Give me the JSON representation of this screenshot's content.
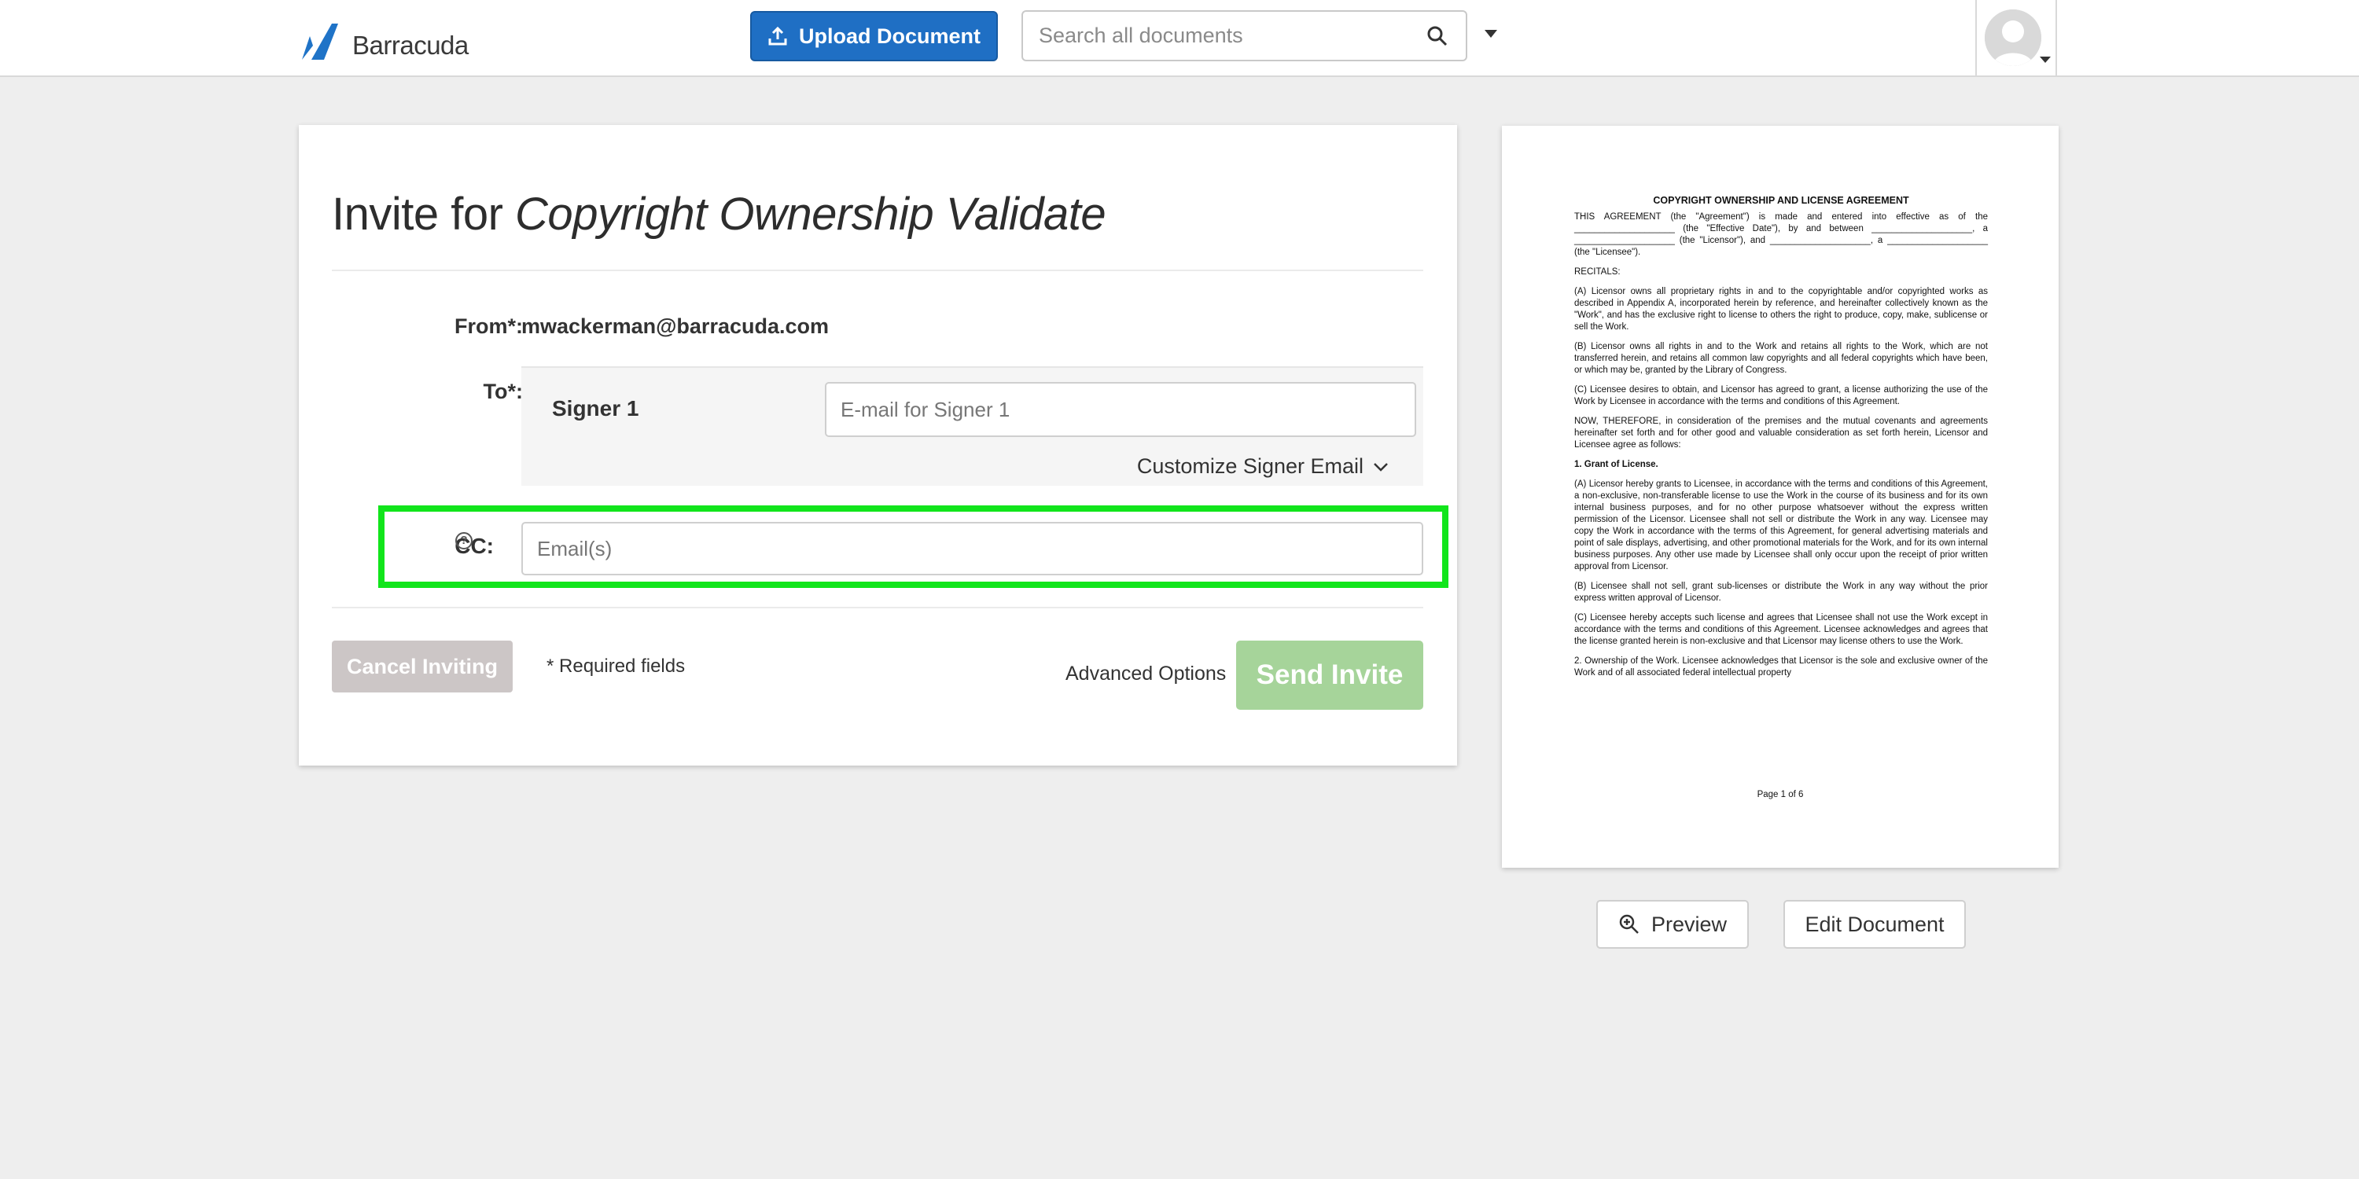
{
  "header": {
    "logo_text": "Barracuda",
    "upload_label": "Upload Document",
    "search_placeholder": "Search all documents"
  },
  "invite": {
    "title_prefix": "Invite for ",
    "title_doc": "Copyright Ownership Validate",
    "from_label": "From*:",
    "from_value": "mwackerman@barracuda.com",
    "to_label": "To*:",
    "signer_name": "Signer 1",
    "signer_placeholder": "E-mail for Signer 1",
    "customize_label": "Customize Signer Email",
    "cc_label": "CC:",
    "cc_placeholder": "Email(s)",
    "cancel_label": "Cancel Inviting",
    "required_note": "* Required fields",
    "advanced_label": "Advanced Options",
    "send_label": "Send Invite"
  },
  "document": {
    "title": "COPYRIGHT OWNERSHIP AND LICENSE AGREEMENT",
    "paragraphs": [
      "THIS AGREEMENT (the \"Agreement\") is made and entered into effective as of the ____________________ (the \"Effective Date\"), by and between ____________________, a ____________________ (the \"Licensor\"), and ____________________, a ____________________ (the \"Licensee\").",
      "RECITALS:",
      "(A) Licensor owns all proprietary rights in and to the copyrightable and/or copyrighted works as described in Appendix A, incorporated herein by reference, and hereinafter collectively known as the \"Work\", and has the exclusive right to license to others the right to produce, copy, make, sublicense or sell the Work.",
      "(B) Licensor owns all rights in and to the Work and retains all rights to the Work, which are not transferred herein, and retains all common law copyrights and all federal copyrights which have been, or which may be, granted by the Library of Congress.",
      "(C) Licensee desires to obtain, and Licensor has agreed to grant, a license authorizing the use of the Work by Licensee in accordance with the terms and conditions of this Agreement.",
      "NOW, THEREFORE, in consideration of the premises and the mutual covenants and agreements hereinafter set forth and for other good and valuable consideration as set forth herein, Licensor and Licensee agree as follows:",
      "1. Grant of License.",
      "(A) Licensor hereby grants to Licensee, in accordance with the terms and conditions of this Agreement, a non-exclusive, non-transferable license to use the Work in the course of its business and for its own internal business purposes, and for no other purpose whatsoever without the express written permission of the Licensor. Licensee shall not sell or distribute the Work in any way. Licensee may copy the Work in accordance with the terms of this Agreement, for general advertising materials and point of sale displays, advertising, and other promotional materials for the Work, and for its own internal business purposes. Any other use made by Licensee shall only occur upon the receipt of prior written approval from Licensor.",
      "(B) Licensee shall not sell, grant sub-licenses or distribute the Work in any way without the prior express written approval of Licensor.",
      "(C) Licensee hereby accepts such license and agrees that Licensee shall not use the Work except in accordance with the terms and conditions of this Agreement. Licensee acknowledges and agrees that the license granted herein is non-exclusive and that Licensor may license others to use the Work.",
      "2. Ownership of the Work. Licensee acknowledges that Licensor is the sole and exclusive owner of the Work and of all associated federal intellectual property"
    ],
    "footer": "Page 1 of 6",
    "preview_label": "Preview",
    "edit_label": "Edit Document"
  }
}
